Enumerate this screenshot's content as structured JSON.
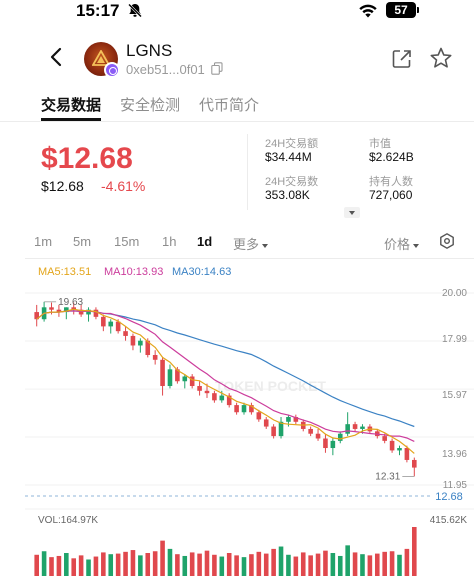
{
  "status_bar": {
    "time": "15:17",
    "icons": [
      "bell-muted-icon",
      "wifi-icon"
    ],
    "battery": "57"
  },
  "header": {
    "back_icon": "chevron-left-icon",
    "token_name": "LGNS",
    "contract_short": "0xeb51...0f01",
    "actions": [
      "share-icon",
      "star-icon"
    ]
  },
  "tabs": [
    {
      "label": "交易数据",
      "active": true
    },
    {
      "label": "安全检测",
      "active": false
    },
    {
      "label": "代币简介",
      "active": false
    }
  ],
  "price": {
    "main": "$12.68",
    "secondary": "$12.68",
    "change": "-4.61%",
    "color_down": "#e5484d"
  },
  "stats": [
    {
      "label": "24H交易额",
      "value": "$34.44M"
    },
    {
      "label": "市值",
      "value": "$2.624B"
    },
    {
      "label": "24H交易数",
      "value": "353.08K"
    },
    {
      "label": "持有人数",
      "value": "727,060"
    }
  ],
  "timeframes": [
    {
      "label": "1m",
      "active": false
    },
    {
      "label": "5m",
      "active": false
    },
    {
      "label": "15m",
      "active": false
    },
    {
      "label": "1h",
      "active": false
    },
    {
      "label": "1d",
      "active": true
    }
  ],
  "more_label": "更多",
  "price_type_label": "价格",
  "chart_data": {
    "type": "candlestick",
    "ma_legend": [
      {
        "label": "MA5:13.51",
        "color": "#e3a51b"
      },
      {
        "label": "MA10:13.93",
        "color": "#cc3d9c"
      },
      {
        "label": "MA30:14.63",
        "color": "#3b82c4"
      }
    ],
    "y_ticks": [
      "20.00",
      "17.99",
      "15.97",
      "13.96",
      "11.95"
    ],
    "current_price_tag": "12.68",
    "high_label": "19.63",
    "low_label": "12.31",
    "volume_label": "VOL:164.97K",
    "volume_max_label": "415.62K",
    "watermark": "TOKEN POCKET",
    "up_color": "#1fa36a",
    "down_color": "#e0484d",
    "ylim": [
      11.95,
      20.0
    ],
    "candles": [
      [
        19.2,
        19.5,
        18.6,
        18.9
      ],
      [
        18.9,
        19.63,
        18.8,
        19.4
      ],
      [
        19.4,
        19.6,
        19.1,
        19.3
      ],
      [
        19.3,
        19.5,
        19.0,
        19.2
      ],
      [
        19.2,
        19.4,
        18.9,
        19.4
      ],
      [
        19.4,
        19.6,
        19.1,
        19.3
      ],
      [
        19.3,
        19.5,
        19.0,
        19.1
      ],
      [
        19.1,
        19.4,
        18.8,
        19.3
      ],
      [
        19.3,
        19.4,
        18.9,
        19.0
      ],
      [
        19.0,
        19.1,
        18.4,
        18.6
      ],
      [
        18.6,
        18.9,
        18.3,
        18.8
      ],
      [
        18.8,
        18.9,
        18.3,
        18.4
      ],
      [
        18.4,
        18.6,
        18.0,
        18.2
      ],
      [
        18.2,
        18.3,
        17.6,
        17.8
      ],
      [
        17.8,
        18.1,
        17.5,
        18.0
      ],
      [
        18.0,
        18.1,
        17.3,
        17.4
      ],
      [
        17.4,
        17.6,
        17.0,
        17.2
      ],
      [
        17.2,
        17.3,
        15.7,
        16.1
      ],
      [
        16.1,
        17.0,
        16.0,
        16.8
      ],
      [
        16.8,
        16.9,
        16.2,
        16.3
      ],
      [
        16.3,
        16.6,
        16.0,
        16.5
      ],
      [
        16.5,
        16.6,
        16.0,
        16.1
      ],
      [
        16.1,
        16.3,
        15.7,
        15.9
      ],
      [
        15.9,
        16.2,
        15.6,
        15.8
      ],
      [
        15.8,
        15.9,
        15.4,
        15.5
      ],
      [
        15.5,
        15.9,
        15.4,
        15.7
      ],
      [
        15.7,
        15.8,
        15.2,
        15.3
      ],
      [
        15.3,
        15.4,
        14.9,
        15.0
      ],
      [
        15.0,
        15.4,
        14.9,
        15.3
      ],
      [
        15.3,
        15.4,
        14.9,
        15.0
      ],
      [
        15.0,
        15.1,
        14.6,
        14.7
      ],
      [
        14.7,
        14.8,
        14.3,
        14.4
      ],
      [
        14.4,
        14.5,
        13.9,
        14.0
      ],
      [
        14.0,
        14.8,
        13.9,
        14.6
      ],
      [
        14.6,
        14.9,
        14.4,
        14.8
      ],
      [
        14.8,
        14.9,
        14.5,
        14.6
      ],
      [
        14.6,
        14.7,
        14.2,
        14.3
      ],
      [
        14.3,
        14.4,
        14.0,
        14.1
      ],
      [
        14.1,
        14.3,
        13.8,
        13.9
      ],
      [
        13.9,
        14.1,
        13.3,
        13.5
      ],
      [
        13.5,
        13.9,
        13.2,
        13.8
      ],
      [
        13.8,
        14.2,
        13.7,
        14.1
      ],
      [
        14.1,
        15.0,
        14.0,
        14.5
      ],
      [
        14.5,
        14.6,
        14.2,
        14.3
      ],
      [
        14.3,
        14.5,
        14.1,
        14.4
      ],
      [
        14.4,
        14.5,
        14.1,
        14.2
      ],
      [
        14.2,
        14.3,
        13.9,
        14.0
      ],
      [
        14.0,
        14.1,
        13.7,
        13.8
      ],
      [
        13.8,
        13.9,
        13.3,
        13.4
      ],
      [
        13.4,
        13.6,
        13.2,
        13.5
      ],
      [
        13.5,
        13.6,
        12.9,
        13.0
      ],
      [
        13.0,
        13.1,
        12.31,
        12.68
      ]
    ],
    "volumes": [
      180,
      210,
      160,
      170,
      195,
      150,
      175,
      140,
      165,
      200,
      185,
      190,
      205,
      220,
      175,
      195,
      210,
      300,
      230,
      185,
      170,
      200,
      190,
      215,
      180,
      165,
      195,
      175,
      160,
      185,
      205,
      190,
      230,
      250,
      180,
      165,
      200,
      175,
      190,
      215,
      195,
      170,
      260,
      200,
      185,
      175,
      190,
      205,
      210,
      180,
      230,
      415.62
    ]
  }
}
